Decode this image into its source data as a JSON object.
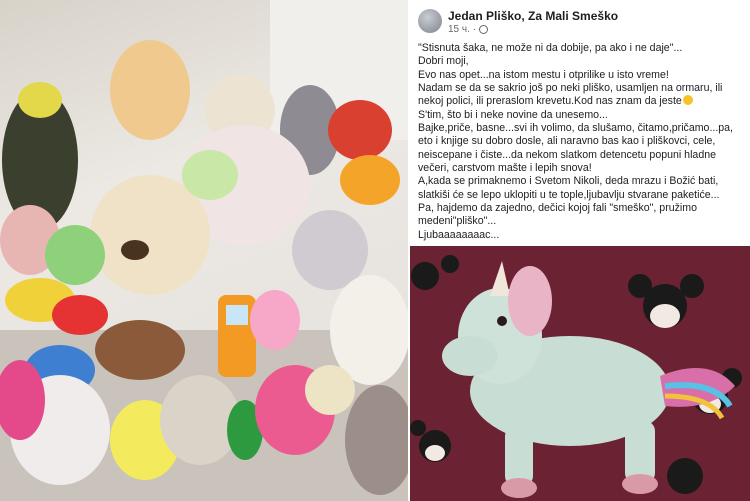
{
  "post": {
    "author": "Jedan Pliško, Za Mali Smeško",
    "time": "15 ч.",
    "privacy_icon": "globe-icon",
    "lines": [
      "\"Stisnuta šaka, ne može ni da dobije, pa ako i ne daje\"...",
      "Dobri moji,",
      "Evo nas opet...na istom mestu i otprilike u isto vreme!",
      "Nadam se da se sakrio još po neki pliško, usamljen na ormaru, ili nekoj polici, ili preraslom krevetu.Kod nas znam da jeste",
      "S'tim, što bi i neke novine da unesemo...",
      "Bajke,priče, basne...svi ih volimo, da slušamo, čitamo,pričamo...pa, eto i knjige su dobro dosle, ali naravno bas kao i pliškovci, cele, neiscepane i čiste...da nekom slatkom detencetu popuni hladne večeri, carstvom mašte i lepih snova!",
      "A,kada se primaknemo i Svetom Nikoli, deda mrazu i Božić bati, slatkiši će se lepo uklopiti u te tople,ljubavlju stvarane paketiće...",
      "Pa, hajdemo da zajedno, dečici kojoj fali \"smeško\", pružimo medeni\"pliško\"...",
      "Ljubaaaaaaaac..."
    ]
  },
  "icons": {
    "avatar": "avatar",
    "emoji": "smiley-emoji-icon"
  },
  "colors": {
    "author": "#1c1e21",
    "meta": "#65676b",
    "unicorn_bg": "#6b2232",
    "unicorn_body": "#c8ddd4"
  }
}
